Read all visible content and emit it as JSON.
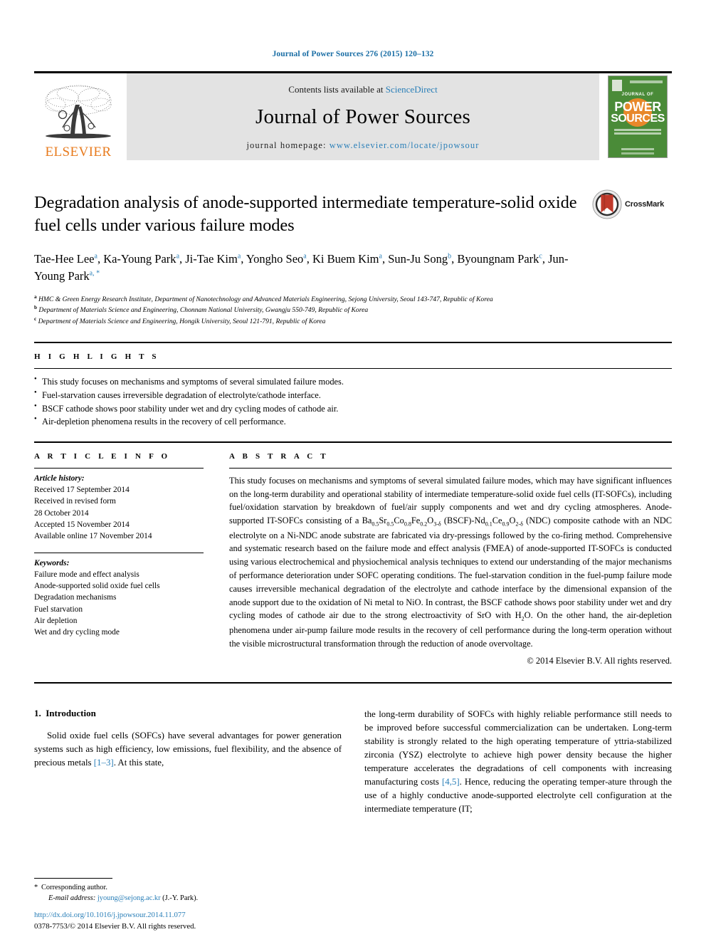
{
  "running_head": "Journal of Power Sources 276 (2015) 120–132",
  "masthead": {
    "publisher": "ELSEVIER",
    "publisher_logo_icon": "elsevier-tree-icon",
    "contents_prefix": "Contents lists available at ",
    "contents_link": "ScienceDirect",
    "journal_title": "Journal of Power Sources",
    "homepage_label": "journal homepage: ",
    "homepage_url": "www.elsevier.com/locate/jpowsour",
    "cover": {
      "line_top": "JOURNAL OF",
      "line_power": "POWER",
      "line_sources": "SOURCES"
    }
  },
  "article": {
    "title": "Degradation analysis of anode-supported intermediate temperature-solid oxide fuel cells under various failure modes",
    "crossmark_label": "CrossMark",
    "authors": [
      {
        "name": "Tae-Hee Lee",
        "marks": "a",
        "sep": ", "
      },
      {
        "name": "Ka-Young Park",
        "marks": "a",
        "sep": ", "
      },
      {
        "name": "Ji-Tae Kim",
        "marks": "a",
        "sep": ", "
      },
      {
        "name": "Yongho Seo",
        "marks": "a",
        "sep": ", "
      },
      {
        "name": "Ki Buem Kim",
        "marks": "a",
        "sep": ", "
      },
      {
        "name": "Sun-Ju Song",
        "marks": "b",
        "sep": ", "
      },
      {
        "name": "Byoungnam Park",
        "marks": "c",
        "sep": ", "
      },
      {
        "name": "Jun-Young Park",
        "marks": "a, *",
        "sep": ""
      }
    ],
    "affiliations": [
      {
        "mark": "a",
        "text": "HMC & Green Energy Research Institute, Department of Nanotechnology and Advanced Materials Engineering, Sejong University, Seoul 143-747, Republic of Korea"
      },
      {
        "mark": "b",
        "text": "Department of Materials Science and Engineering, Chonnam National University, Gwangju 550-749, Republic of Korea"
      },
      {
        "mark": "c",
        "text": "Department of Materials Science and Engineering, Hongik University, Seoul 121-791, Republic of Korea"
      }
    ]
  },
  "highlights": {
    "heading": "H I G H L I G H T S",
    "items": [
      "This study focuses on mechanisms and symptoms of several simulated failure modes.",
      "Fuel-starvation causes irreversible degradation of electrolyte/cathode interface.",
      "BSCF cathode shows poor stability under wet and dry cycling modes of cathode air.",
      "Air-depletion phenomena results in the recovery of cell performance."
    ]
  },
  "article_info": {
    "heading": "A R T I C L E    I N F O",
    "history_label": "Article history:",
    "history_lines": [
      "Received 17 September 2014",
      "Received in revised form",
      "28 October 2014",
      "Accepted 15 November 2014",
      "Available online 17 November 2014"
    ],
    "keywords_label": "Keywords:",
    "keywords": [
      "Failure mode and effect analysis",
      "Anode-supported solid oxide fuel cells",
      "Degradation mechanisms",
      "Fuel starvation",
      "Air depletion",
      "Wet and dry cycling mode"
    ]
  },
  "abstract": {
    "heading": "A B S T R A C T",
    "part1": "This study focuses on mechanisms and symptoms of several simulated failure modes, which may have significant influences on the long-term durability and operational stability of intermediate temperature-solid oxide fuel cells (IT-SOFCs), including fuel/oxidation starvation by breakdown of fuel/air supply components and wet and dry cycling atmospheres. Anode-supported IT-SOFCs consisting of a Ba",
    "f1_sub1": "0.5",
    "f1_mid1": "Sr",
    "f1_sub2": "0.5",
    "f1_mid2": "Co",
    "f1_sub3": "0.8",
    "f1_mid3": "Fe",
    "f1_sub4": "0.2",
    "f1_mid4": "O",
    "f1_sub5": "3-δ",
    "part2": " (BSCF)-Nd",
    "f2_sub1": "0.1",
    "f2_mid1": "Ce",
    "f2_sub2": "0.9",
    "f2_mid2": "O",
    "f2_sub3": "2-δ",
    "part3": " (NDC) composite cathode with an NDC electrolyte on a Ni-NDC anode substrate are fabricated via dry-pressings followed by the co-firing method. Comprehensive and systematic research based on the failure mode and effect analysis (FMEA) of anode-supported IT-SOFCs is conducted using various electrochemical and physiochemical analysis techniques to extend our understanding of the major mechanisms of performance deterioration under SOFC operating conditions. The fuel-starvation condition in the fuel-pump failure mode causes irreversible mechanical degradation of the electrolyte and cathode interface by the dimensional expansion of the anode support due to the oxidation of Ni metal to NiO. In contrast, the BSCF cathode shows poor stability under wet and dry cycling modes of cathode air due to the strong electroactivity of SrO with H",
    "f3_sub1": "2",
    "part4": "O. On the other hand, the air-depletion phenomena under air-pump failure mode results in the recovery of cell performance during the long-term operation without the visible microstructural transformation through the reduction of anode overvoltage.",
    "copyright": "© 2014 Elsevier B.V. All rights reserved."
  },
  "body": {
    "section_number": "1.",
    "section_title": "Introduction",
    "left_para_1": "Solid oxide fuel cells (SOFCs) have several advantages for power generation systems such as high efficiency, low emissions, fuel flexibility, and the absence of precious metals ",
    "left_ref_1": "[1–3]",
    "left_para_1b": ". At this state,",
    "right_para_1a": "the long-term durability of SOFCs with highly reliable performance still needs to be improved before successful commercialization can be undertaken. Long-term stability is strongly related to the high operating temperature of yttria-stabilized zirconia (YSZ) electrolyte to achieve high power density because the higher temperature accelerates the degradations of cell components with increasing manufacturing costs ",
    "right_ref_1": "[4,5]",
    "right_para_1b": ". Hence, reducing the operating temper-ature through the use of a highly conductive anode-supported electrolyte cell configuration at the intermediate temperature (IT;"
  },
  "footnote": {
    "star": "*",
    "corresponding": "Corresponding author.",
    "email_label": "E-mail address: ",
    "email": "jyoung@sejong.ac.kr",
    "email_suffix": " (J.-Y. Park)."
  },
  "imprint": {
    "doi": "http://dx.doi.org/10.1016/j.jpowsour.2014.11.077",
    "issn_line": "0378-7753/© 2014 Elsevier B.V. All rights reserved."
  },
  "colors": {
    "link_blue": "#2a7fb8",
    "head_blue": "#1a6ea5",
    "elsevier_orange": "#e87b1e",
    "band_grey": "#e3e3e3",
    "cover_green": "#4a8b38"
  }
}
